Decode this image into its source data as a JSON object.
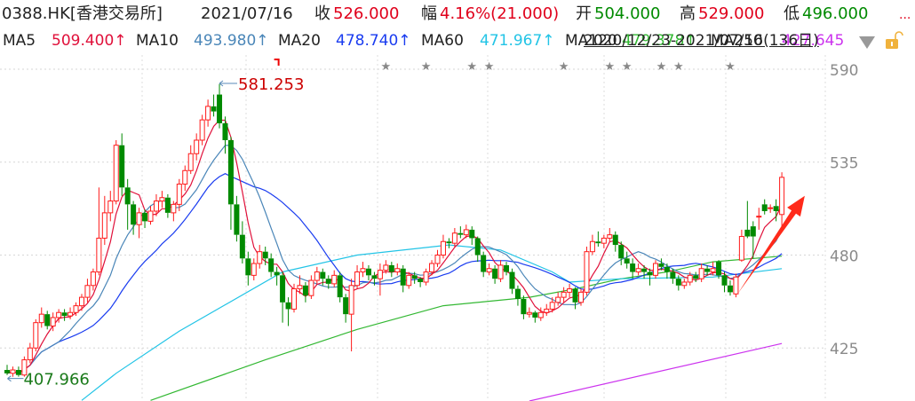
{
  "header": {
    "symbol": "0388.HK[香港交易所]",
    "date": "2021/07/16",
    "close_label": "收",
    "close_value": "526.000",
    "change_label": "幅",
    "change_value": "4.16%(21.000)",
    "open_label": "开",
    "open_value": "504.000",
    "high_label": "高",
    "high_value": "529.000",
    "low_label": "低",
    "low_value": "496.000",
    "more": "..."
  },
  "ma_legend": {
    "ma5_label": "MA5",
    "ma5_value": "509.400↑",
    "ma10_label": "MA10",
    "ma10_value": "493.980↑",
    "ma20_label": "MA20",
    "ma20_value": "478.740↑",
    "ma60_label": "MA60",
    "ma60_value": "471.967↑",
    "ma120_label": "MA120",
    "ma120_value": "479.378↑",
    "ma250_label": "MA250",
    "ma250_value": "427.645",
    "range_text": "2020/12/23-2021/07/16(136日)"
  },
  "icons": {
    "dropdown": "triangle-down-icon",
    "lock": "unlocked-padlock-icon"
  },
  "colors": {
    "up": "#ff1a1a",
    "down": "#008a00",
    "ma5": "#e0103a",
    "ma10": "#4a86b8",
    "ma20": "#1a3cf0",
    "ma60": "#22c4e6",
    "ma120": "#33b833",
    "ma250": "#cc33ee",
    "arrow": "#ff2a1a",
    "star": "#888888"
  },
  "chart_data": {
    "type": "candlestick",
    "ylim": [
      393.6,
      599
    ],
    "y_ticks": [
      "590",
      "535",
      "480",
      "425"
    ],
    "grid": true,
    "max_annotation": {
      "index": 37,
      "value": "581.253"
    },
    "min_annotation": {
      "index": 1,
      "value": "407.966"
    },
    "event_marker_indices": [
      66,
      73,
      81,
      84,
      97,
      105,
      108,
      114,
      117,
      126
    ],
    "flag_marker_index": 47,
    "trend_arrow": {
      "from": [
        127,
        455
      ],
      "to": [
        139,
        515
      ]
    },
    "ohlc": [
      [
        412,
        415,
        409,
        410
      ],
      [
        410,
        414,
        407.966,
        412
      ],
      [
        412,
        414,
        408,
        409
      ],
      [
        409,
        420,
        408,
        418
      ],
      [
        418,
        428,
        416,
        425
      ],
      [
        425,
        442,
        423,
        440
      ],
      [
        440,
        449,
        437,
        445
      ],
      [
        445,
        447,
        436,
        438
      ],
      [
        438,
        446,
        435,
        443
      ],
      [
        443,
        448,
        440,
        446
      ],
      [
        446,
        448,
        441,
        444
      ],
      [
        444,
        449,
        442,
        446
      ],
      [
        446,
        452,
        444,
        450
      ],
      [
        450,
        457,
        447,
        455
      ],
      [
        455,
        466,
        452,
        462
      ],
      [
        462,
        472,
        459,
        470
      ],
      [
        470,
        520,
        468,
        490
      ],
      [
        490,
        515,
        486,
        505
      ],
      [
        505,
        518,
        500,
        512
      ],
      [
        512,
        548,
        510,
        545
      ],
      [
        545,
        552,
        515,
        520
      ],
      [
        520,
        525,
        495,
        510
      ],
      [
        510,
        512,
        492,
        498
      ],
      [
        498,
        508,
        490,
        505
      ],
      [
        505,
        507,
        496,
        500
      ],
      [
        500,
        509,
        498,
        506
      ],
      [
        506,
        516,
        503,
        512
      ],
      [
        512,
        518,
        508,
        514
      ],
      [
        514,
        516,
        502,
        505
      ],
      [
        505,
        512,
        500,
        510
      ],
      [
        510,
        525,
        506,
        522
      ],
      [
        522,
        533,
        518,
        530
      ],
      [
        530,
        545,
        528,
        540
      ],
      [
        540,
        552,
        536,
        548
      ],
      [
        548,
        563,
        545,
        560
      ],
      [
        560,
        572,
        556,
        568
      ],
      [
        568,
        575,
        562,
        565
      ],
      [
        575,
        581.253,
        555,
        558
      ],
      [
        558,
        562,
        540,
        548
      ],
      [
        548,
        550,
        495,
        510
      ],
      [
        510,
        515,
        488,
        492
      ],
      [
        492,
        500,
        475,
        478
      ],
      [
        478,
        482,
        462,
        468
      ],
      [
        468,
        478,
        465,
        475
      ],
      [
        475,
        486,
        472,
        482
      ],
      [
        482,
        485,
        474,
        478
      ],
      [
        478,
        481,
        467,
        470
      ],
      [
        470,
        473,
        462,
        468
      ],
      [
        468,
        470,
        440,
        452
      ],
      [
        452,
        455,
        438,
        448
      ],
      [
        448,
        463,
        446,
        460
      ],
      [
        460,
        468,
        457,
        462
      ],
      [
        462,
        464,
        452,
        456
      ],
      [
        456,
        468,
        454,
        465
      ],
      [
        465,
        473,
        463,
        470
      ],
      [
        470,
        472,
        462,
        466
      ],
      [
        466,
        468,
        460,
        463
      ],
      [
        463,
        471,
        461,
        468
      ],
      [
        468,
        470,
        452,
        455
      ],
      [
        455,
        457,
        440,
        445
      ],
      [
        445,
        466,
        423,
        462
      ],
      [
        462,
        474,
        460,
        470
      ],
      [
        470,
        476,
        467,
        472
      ],
      [
        472,
        474,
        465,
        468
      ],
      [
        468,
        470,
        462,
        466
      ],
      [
        466,
        475,
        456,
        471
      ],
      [
        471,
        477,
        469,
        474
      ],
      [
        474,
        476,
        467,
        470
      ],
      [
        470,
        475,
        468,
        472
      ],
      [
        472,
        474,
        458,
        462
      ],
      [
        462,
        470,
        460,
        468
      ],
      [
        468,
        470,
        463,
        466
      ],
      [
        466,
        467,
        461,
        464
      ],
      [
        464,
        472,
        462,
        470
      ],
      [
        470,
        477,
        468,
        475
      ],
      [
        475,
        483,
        473,
        480
      ],
      [
        480,
        492,
        478,
        488
      ],
      [
        488,
        490,
        484,
        487
      ],
      [
        487,
        496,
        485,
        493
      ],
      [
        493,
        497,
        490,
        492
      ],
      [
        492,
        498,
        490,
        495
      ],
      [
        495,
        497,
        486,
        490
      ],
      [
        490,
        491,
        476,
        480
      ],
      [
        480,
        482,
        467,
        470
      ],
      [
        470,
        475,
        468,
        472
      ],
      [
        472,
        474,
        463,
        466
      ],
      [
        466,
        477,
        464,
        474
      ],
      [
        474,
        476,
        468,
        470
      ],
      [
        470,
        472,
        457,
        460
      ],
      [
        460,
        462,
        450,
        454
      ],
      [
        454,
        456,
        442,
        445
      ],
      [
        445,
        449,
        443,
        446
      ],
      [
        446,
        447,
        440,
        443
      ],
      [
        443,
        449,
        441,
        446
      ],
      [
        446,
        451,
        444,
        448
      ],
      [
        448,
        455,
        446,
        452
      ],
      [
        452,
        458,
        450,
        455
      ],
      [
        455,
        461,
        452,
        458
      ],
      [
        458,
        463,
        455,
        460
      ],
      [
        460,
        461,
        448,
        452
      ],
      [
        452,
        460,
        450,
        458
      ],
      [
        458,
        485,
        456,
        482
      ],
      [
        482,
        492,
        480,
        488
      ],
      [
        488,
        494,
        485,
        487
      ],
      [
        487,
        492,
        484,
        490
      ],
      [
        490,
        496,
        488,
        492
      ],
      [
        492,
        494,
        482,
        486
      ],
      [
        486,
        488,
        474,
        478
      ],
      [
        478,
        482,
        472,
        475
      ],
      [
        475,
        478,
        466,
        470
      ],
      [
        470,
        475,
        468,
        472
      ],
      [
        472,
        474,
        466,
        470
      ],
      [
        470,
        472,
        462,
        468
      ],
      [
        468,
        477,
        466,
        475
      ],
      [
        475,
        478,
        471,
        473
      ],
      [
        473,
        475,
        466,
        470
      ],
      [
        470,
        472,
        463,
        466
      ],
      [
        466,
        468,
        459,
        462
      ],
      [
        462,
        466,
        460,
        464
      ],
      [
        464,
        470,
        462,
        468
      ],
      [
        468,
        470,
        464,
        466
      ],
      [
        466,
        475,
        464,
        472
      ],
      [
        472,
        474,
        468,
        470
      ],
      [
        470,
        476,
        468,
        472
      ],
      [
        476,
        477,
        466,
        468
      ],
      [
        468,
        470,
        458,
        462
      ],
      [
        462,
        465,
        456,
        458
      ],
      [
        457,
        469,
        455,
        467
      ],
      [
        477,
        495,
        476,
        491
      ],
      [
        495,
        512,
        490,
        491
      ],
      [
        497,
        500,
        478,
        491
      ],
      [
        503,
        508,
        495,
        503
      ],
      [
        510,
        513,
        504,
        506
      ],
      [
        508,
        510,
        505,
        508
      ],
      [
        509,
        513,
        500,
        506
      ],
      [
        504,
        529,
        496,
        526
      ]
    ],
    "ma60_points": [
      [
        13,
        394
      ],
      [
        19,
        410
      ],
      [
        30,
        435
      ],
      [
        48,
        470
      ],
      [
        61,
        480
      ],
      [
        77,
        486
      ],
      [
        86,
        483
      ],
      [
        95,
        470
      ],
      [
        98,
        464
      ],
      [
        107,
        466
      ],
      [
        123,
        467
      ],
      [
        135,
        471.967
      ]
    ],
    "ma120_points": [
      [
        25,
        394
      ],
      [
        45,
        418
      ],
      [
        61,
        436
      ],
      [
        76,
        450
      ],
      [
        91,
        455
      ],
      [
        99,
        460
      ],
      [
        107,
        466
      ],
      [
        115,
        470
      ],
      [
        123,
        476
      ],
      [
        135,
        479.378
      ]
    ],
    "ma250_points": [
      [
        91,
        393.6
      ],
      [
        135,
        427.645
      ]
    ]
  }
}
